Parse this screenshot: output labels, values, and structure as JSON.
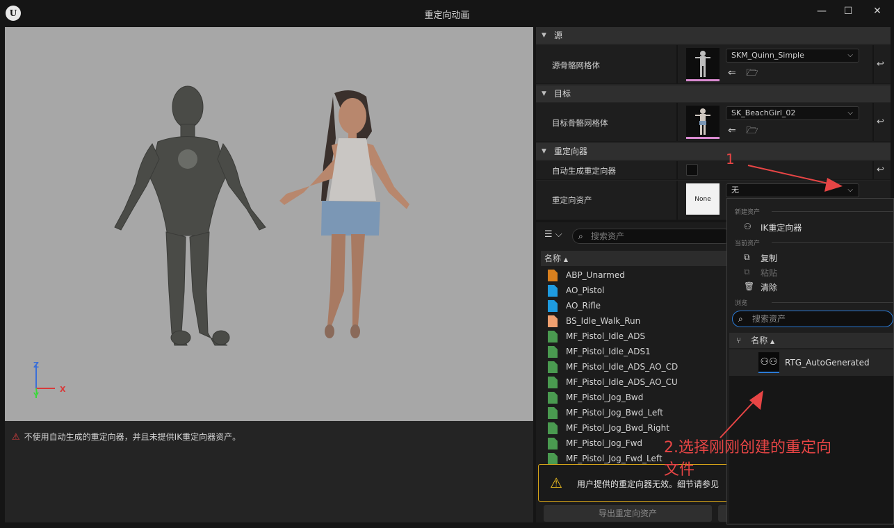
{
  "window": {
    "title": "重定向动画",
    "logo": "U",
    "buttons": {
      "minimize": "—",
      "maximize": "☐",
      "close": "✕"
    }
  },
  "viewport": {
    "axes": {
      "z": "Z",
      "y": "Y",
      "x": "X"
    },
    "status_message": "不使用自动生成的重定向器，并且未提供IK重定向器资产。"
  },
  "details": {
    "source": {
      "category": "源",
      "mesh_label": "源骨骼网格体",
      "mesh_value": "SKM_Quinn_Simple"
    },
    "target": {
      "category": "目标",
      "mesh_label": "目标骨骼网格体",
      "mesh_value": "SK_BeachGirl_02"
    },
    "retargeter": {
      "category": "重定向器",
      "auto_label": "自动生成重定向器",
      "asset_label": "重定向资产",
      "asset_thumb": "None",
      "asset_value": "无"
    }
  },
  "browser": {
    "search_placeholder": "搜索资产",
    "column_name": "名称",
    "assets": [
      {
        "name": "ABP_Unarmed",
        "color": "#d9801e"
      },
      {
        "name": "AO_Pistol",
        "color": "#1e9be0"
      },
      {
        "name": "AO_Rifle",
        "color": "#1e9be0"
      },
      {
        "name": "BS_Idle_Walk_Run",
        "color": "#f0a070"
      },
      {
        "name": "MF_Pistol_Idle_ADS",
        "color": "#4a9a50"
      },
      {
        "name": "MF_Pistol_Idle_ADS1",
        "color": "#4a9a50"
      },
      {
        "name": "MF_Pistol_Idle_ADS_AO_CD",
        "color": "#4a9a50"
      },
      {
        "name": "MF_Pistol_Idle_ADS_AO_CU",
        "color": "#4a9a50"
      },
      {
        "name": "MF_Pistol_Jog_Bwd",
        "color": "#4a9a50"
      },
      {
        "name": "MF_Pistol_Jog_Bwd_Left",
        "color": "#4a9a50"
      },
      {
        "name": "MF_Pistol_Jog_Bwd_Right",
        "color": "#4a9a50"
      },
      {
        "name": "MF_Pistol_Jog_Fwd",
        "color": "#4a9a50"
      },
      {
        "name": "MF_Pistol_Jog_Fwd_Left",
        "color": "#4a9a50"
      }
    ],
    "warning": "用户提供的重定向器无效。细节请参见",
    "export_button": "导出重定向资产"
  },
  "popup": {
    "section_new": "新建资产",
    "item_ik": "IK重定向器",
    "section_current": "当前资产",
    "item_copy": "复制",
    "item_paste": "粘贴",
    "item_clear": "清除",
    "section_browse": "浏览",
    "search_placeholder": "搜索资产",
    "column_name": "名称",
    "asset_name": "RTG_AutoGenerated"
  },
  "annotations": {
    "step1": "1",
    "step2_line1": "2.选择刚刚创建的重定向",
    "step2_line2": "文件"
  }
}
